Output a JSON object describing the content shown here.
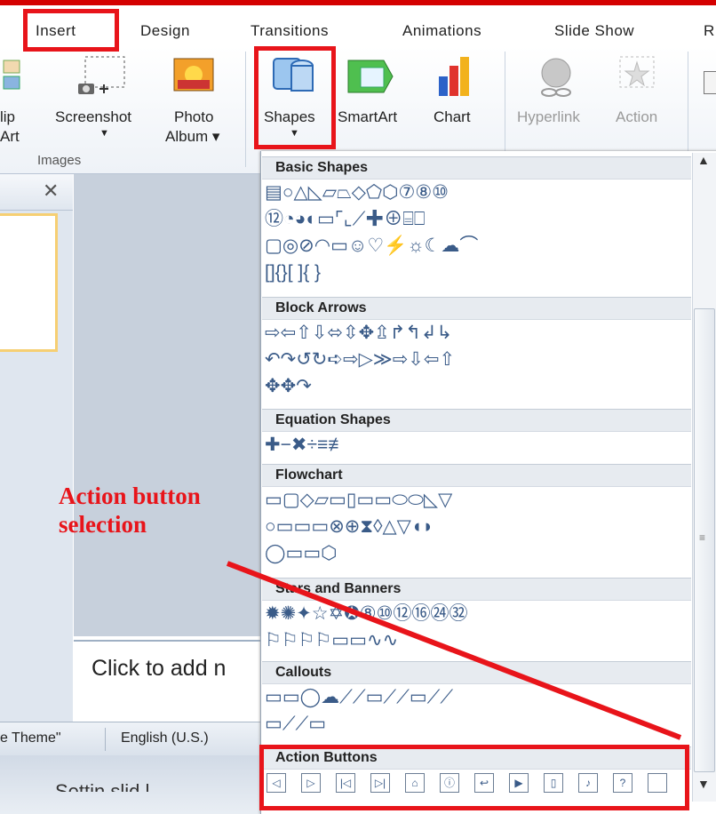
{
  "tabs": [
    "Insert",
    "Design",
    "Transitions",
    "Animations",
    "Slide Show",
    "R"
  ],
  "ribbon": {
    "clipart": {
      "line1": "lip",
      "line2": "Art"
    },
    "screenshot": "Screenshot",
    "photo_album": {
      "line1": "Photo",
      "line2": "Album ▾"
    },
    "shapes": "Shapes",
    "smartart": "SmartArt",
    "chart": "Chart",
    "hyperlink": "Hyperlink",
    "action": "Action",
    "images_group": "Images"
  },
  "sections": {
    "basic": "Basic Shapes",
    "block": "Block Arrows",
    "equation": "Equation Shapes",
    "flowchart": "Flowchart",
    "stars": "Stars and Banners",
    "callouts": "Callouts",
    "action": "Action Buttons"
  },
  "shapes": {
    "basic1": "▤○△◺▱⏢◇⬠⬡⑦⑧⑩",
    "basic2": "⑫◔◕◐▭⌜⌞⟋✚⊕⌸⎕",
    "basic3": "▢◎⊘◠▭☺♡⚡☼☾☁⌒",
    "basic4": "[]{}[ ]{ }",
    "block1": "⇨⇦⇧⇩⬄⇳✥⇫↱↰↲↳",
    "block2": "↶↷↺↻➪⇨▷≫⇨⇩⇦⇧",
    "block3": "✥✥↷",
    "equation1": "✚−✖÷≡≢",
    "flow1": "▭▢◇▱▭▯▭▭⬭⬭◺▽",
    "flow2": "○▭▭▭⊗⊕⧗◊△▽◖◗",
    "flow3": "◯▭▭⬡",
    "stars1": "✹✺✦☆✡✪⑧⑩⑫⑯㉔㉜",
    "stars2": "⚐⚐⚐⚐▭▭∿∿",
    "callouts1": "▭▭◯☁⟋⟋▭⟋⟋▭⟋⟋",
    "callouts2": "▭⟋⟋▭"
  },
  "action_buttons": [
    "◁",
    "▷",
    "|◁",
    "▷|",
    "⌂",
    "ⓘ",
    "↩",
    "▶",
    "▯",
    "♪",
    "?",
    ""
  ],
  "notes_placeholder": "Click to add n",
  "status": {
    "theme": "e Theme\"",
    "language": "English (U.S.)"
  },
  "bottom_text": "Settin  slid  l",
  "annotation": {
    "line1": "Action button",
    "line2": "selection"
  },
  "colors": {
    "highlight": "#e8141a",
    "shape_stroke": "#3a5b88"
  }
}
